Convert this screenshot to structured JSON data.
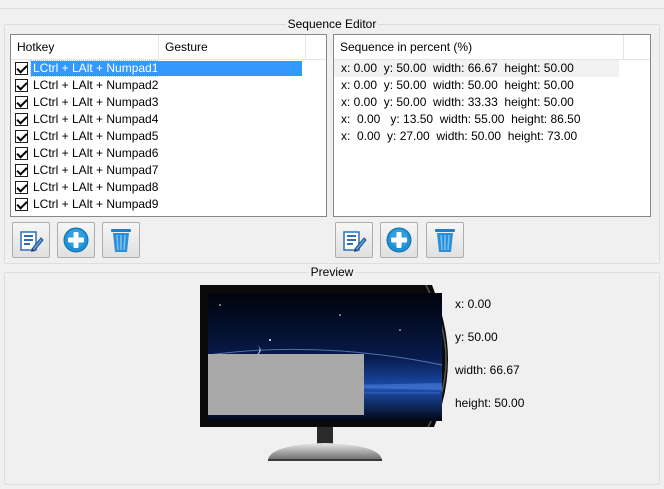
{
  "sequence_editor": {
    "title": "Sequence Editor",
    "hotkey_list": {
      "columns": [
        "Hotkey",
        "Gesture"
      ],
      "rows": [
        {
          "hotkey": "LCtrl + LAlt + Numpad1",
          "gesture": "",
          "checked": true,
          "selected": true
        },
        {
          "hotkey": "LCtrl + LAlt + Numpad2",
          "gesture": "",
          "checked": true,
          "selected": false
        },
        {
          "hotkey": "LCtrl + LAlt + Numpad3",
          "gesture": "",
          "checked": true,
          "selected": false
        },
        {
          "hotkey": "LCtrl + LAlt + Numpad4",
          "gesture": "",
          "checked": true,
          "selected": false
        },
        {
          "hotkey": "LCtrl + LAlt + Numpad5",
          "gesture": "",
          "checked": true,
          "selected": false
        },
        {
          "hotkey": "LCtrl + LAlt + Numpad6",
          "gesture": "",
          "checked": true,
          "selected": false
        },
        {
          "hotkey": "LCtrl + LAlt + Numpad7",
          "gesture": "",
          "checked": true,
          "selected": false
        },
        {
          "hotkey": "LCtrl + LAlt + Numpad8",
          "gesture": "",
          "checked": true,
          "selected": false
        },
        {
          "hotkey": "LCtrl + LAlt + Numpad9",
          "gesture": "",
          "checked": true,
          "selected": false
        }
      ]
    },
    "sequence_list": {
      "columns": [
        "Sequence in percent (%)"
      ],
      "rows": [
        "x: 0.00  y: 50.00  width: 66.67  height: 50.00",
        "x: 0.00  y: 50.00  width: 50.00  height: 50.00",
        "x: 0.00  y: 50.00  width: 33.33  height: 50.00",
        "x:  0.00   y: 13.50  width: 55.00  height: 86.50",
        "x:  0.00  y: 27.00  width: 50.00  height: 73.00"
      ]
    },
    "toolbar_icons": [
      "edit-icon",
      "add-icon",
      "delete-icon"
    ]
  },
  "preview": {
    "title": "Preview",
    "x_label": "x: 0.00",
    "y_label": "y: 50.00",
    "width_label": "width: 66.67",
    "height_label": "height: 50.00"
  },
  "colors": {
    "selection": "#3399ff",
    "add_blue": "#1e90d6",
    "trash_blue": "#2a8fd8",
    "placeholder_gray": "#a9a9a9"
  }
}
